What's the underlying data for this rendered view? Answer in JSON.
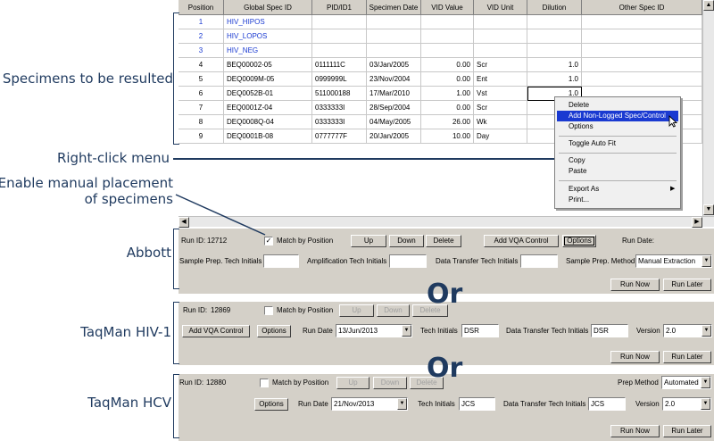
{
  "annotations": {
    "specimens": "Specimens to be resulted",
    "right_click": "Right-click menu",
    "manual_line1": "Enable manual placement",
    "manual_line2": "of specimens",
    "abbott": "Abbott",
    "taqman_hiv": "TaqMan HIV-1",
    "taqman_hcv": "TaqMan HCV",
    "or": "Or"
  },
  "grid": {
    "columns": [
      "Position",
      "Global Spec ID",
      "PID/ID1",
      "Specimen Date",
      "VID Value",
      "VID Unit",
      "Dilution",
      "Other Spec ID"
    ],
    "rows": [
      {
        "pos": "1",
        "spec": "HIV_HIPOS",
        "pid": "",
        "date": "",
        "vid": "",
        "unit": "",
        "dil": "",
        "other": "",
        "control": true
      },
      {
        "pos": "2",
        "spec": "HIV_LOPOS",
        "pid": "",
        "date": "",
        "vid": "",
        "unit": "",
        "dil": "",
        "other": "",
        "control": true
      },
      {
        "pos": "3",
        "spec": "HIV_NEG",
        "pid": "",
        "date": "",
        "vid": "",
        "unit": "",
        "dil": "",
        "other": "",
        "control": true
      },
      {
        "pos": "4",
        "spec": "BEQ00002-05",
        "pid": "0111111C",
        "date": "03/Jan/2005",
        "vid": "0.00",
        "unit": "Scr",
        "dil": "1.0",
        "other": "",
        "control": false
      },
      {
        "pos": "5",
        "spec": "DEQ0009M-05",
        "pid": "0999999L",
        "date": "23/Nov/2004",
        "vid": "0.00",
        "unit": "Ent",
        "dil": "1.0",
        "other": "",
        "control": false
      },
      {
        "pos": "6",
        "spec": "DEQ0052B-01",
        "pid": "511000188",
        "date": "17/Mar/2010",
        "vid": "1.00",
        "unit": "Vst",
        "dil": "1.0",
        "other": "",
        "control": false
      },
      {
        "pos": "7",
        "spec": "EEQ0001Z-04",
        "pid": "0333333I",
        "date": "28/Sep/2004",
        "vid": "0.00",
        "unit": "Scr",
        "dil": "",
        "other": "",
        "control": false
      },
      {
        "pos": "8",
        "spec": "DEQ0008Q-04",
        "pid": "0333333I",
        "date": "04/May/2005",
        "vid": "26.00",
        "unit": "Wk",
        "dil": "",
        "other": "",
        "control": false
      },
      {
        "pos": "9",
        "spec": "DEQ0001B-08",
        "pid": "0777777F",
        "date": "20/Jan/2005",
        "vid": "10.00",
        "unit": "Day",
        "dil": "",
        "other": "",
        "control": false
      }
    ]
  },
  "context_menu": {
    "items": [
      "Delete",
      "Add Non-Logged Spec/Control",
      "Options",
      "Toggle Auto Fit",
      "Copy",
      "Paste",
      "Export As",
      "Print..."
    ]
  },
  "abbott": {
    "run_id_label": "Run ID:",
    "run_id": "12712",
    "match_label": "Match by Position",
    "match_checked": "✓",
    "up": "Up",
    "down": "Down",
    "delete": "Delete",
    "add_vqa": "Add VQA Control",
    "options": "Options",
    "run_date_label": "Run Date:",
    "sample_prep_label": "Sample Prep. Tech Initials",
    "amp_label": "Amplification Tech Initials",
    "dt_label": "Data Transfer Tech Initials",
    "method_label": "Sample Prep. Method",
    "method_value": "Manual Extraction",
    "run_now": "Run Now",
    "run_later": "Run Later"
  },
  "taqman_hiv": {
    "run_id_label": "Run ID:",
    "run_id": "12869",
    "match_label": "Match by Position",
    "up": "Up",
    "down": "Down",
    "delete": "Delete",
    "add_vqa": "Add VQA Control",
    "options": "Options",
    "run_date_label": "Run Date",
    "run_date": "13/Jun/2013",
    "tech_label": "Tech Initials",
    "tech_value": "DSR",
    "dt_label": "Data Transfer Tech Initials",
    "dt_value": "DSR",
    "version_label": "Version",
    "version_value": "2.0",
    "run_now": "Run Now",
    "run_later": "Run Later"
  },
  "taqman_hcv": {
    "run_id_label": "Run ID:",
    "run_id": "12880",
    "match_label": "Match by Position",
    "up": "Up",
    "down": "Down",
    "delete": "Delete",
    "prep_label": "Prep Method",
    "prep_value": "Automated",
    "options": "Options",
    "run_date_label": "Run Date",
    "run_date": "21/Nov/2013",
    "tech_label": "Tech Initials",
    "tech_value": "JCS",
    "dt_label": "Data Transfer Tech Initials",
    "dt_value": "JCS",
    "version_label": "Version",
    "version_value": "2.0",
    "run_now": "Run Now",
    "run_later": "Run Later"
  }
}
